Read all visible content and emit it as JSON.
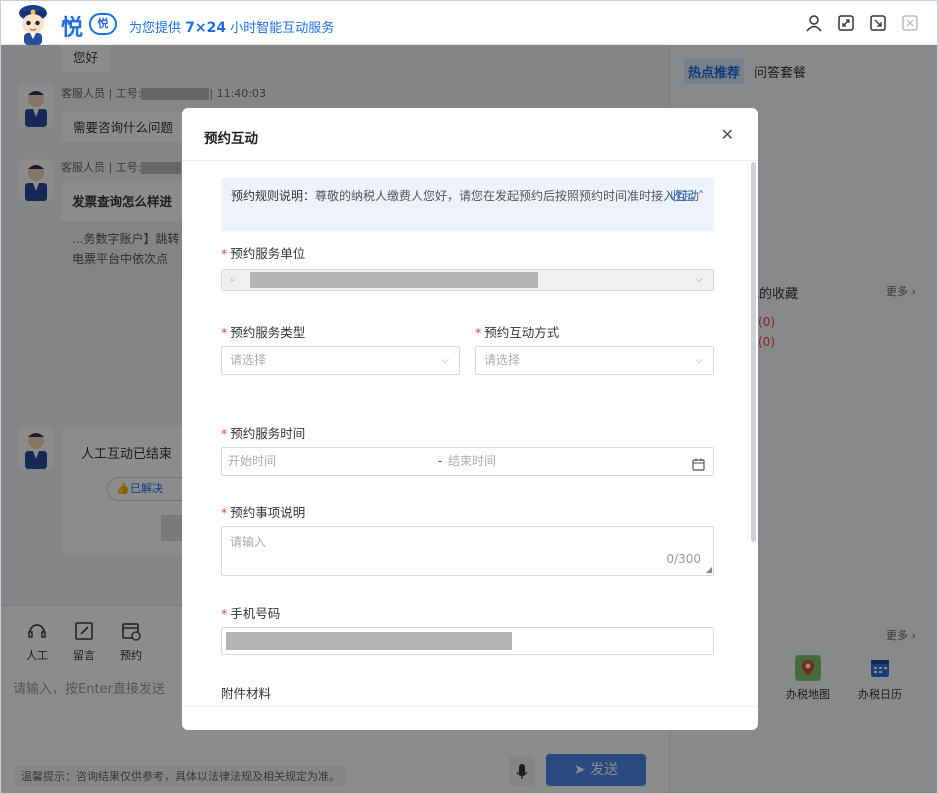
{
  "header": {
    "logo_text": "悦",
    "logo_badge": "悦",
    "tagline_prefix": "为您提供 ",
    "tagline_bold": "7×24",
    "tagline_suffix": " 小时智能互动服务"
  },
  "chat": {
    "greeting": "您好",
    "agent_meta_1_prefix": "客服人员 | 工号:",
    "agent_meta_1_suffix": "| 11:40:03",
    "agent_msg_1": "需要咨询什么问题",
    "agent_meta_2_prefix": "客服人员 | 工号:",
    "agent_msg_2": "发票查询怎么样进",
    "card_text_line1": "...务数字账户】跳转",
    "card_text_line2": "电票平台中依次点",
    "ended_text": "人工互动已结束",
    "resolved_label": "已解决"
  },
  "right_panel": {
    "tab_hot": "热点推荐",
    "tab_qa": "问答套餐",
    "favorites_label": "我的收藏",
    "more_label_1": "更多",
    "count_1": "(0)",
    "count_2": "(0)",
    "more_label_2": "更多",
    "tool_map": "办税地图",
    "tool_calendar": "办税日历"
  },
  "composer": {
    "tool_human": "人工",
    "tool_message": "留言",
    "tool_appointment": "预约",
    "input_placeholder": "请输入，按Enter直接发送",
    "tip": "温馨提示：咨询结果仅供参考，具体以法律法规及相关规定为准。",
    "send_label": "发送"
  },
  "modal": {
    "title": "预约互动",
    "close_icon": "close-icon",
    "notice_rule_label": "预约规则说明：",
    "notice_text": "尊敬的纳税人缴费人您好，请您在发起预约后按照预约时间准时接入互动",
    "notice_collapse": "收起",
    "service_unit_label": "预约服务单位",
    "service_type_label": "预约服务类型",
    "service_type_placeholder": "请选择",
    "interaction_mode_label": "预约互动方式",
    "interaction_mode_placeholder": "请选择",
    "service_time_label": "预约服务时间",
    "start_time_placeholder": "开始时间",
    "time_separator": "-",
    "end_time_placeholder": "结束时间",
    "description_label": "预约事项说明",
    "description_placeholder": "请输入",
    "description_counter": "0/300",
    "phone_label": "手机号码",
    "attachment_label": "附件材料"
  },
  "colors": {
    "brand": "#1e6fe0",
    "required": "#e6453a",
    "send_button": "#4b87e8"
  }
}
